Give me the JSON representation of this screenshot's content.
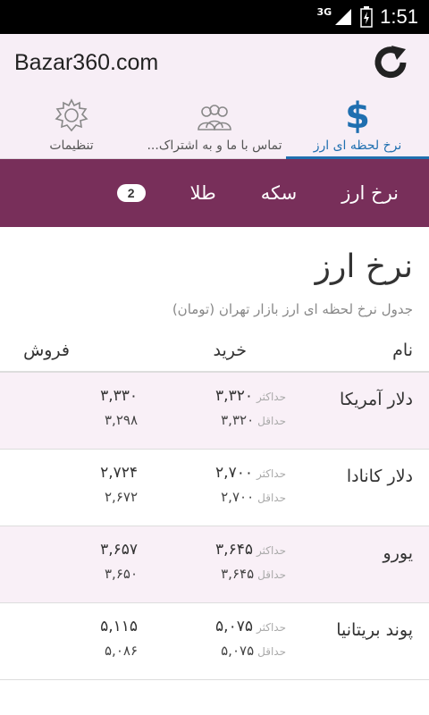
{
  "status": {
    "network": "3G",
    "time": "1:51"
  },
  "app": {
    "title": "Bazar360.com"
  },
  "tabs": [
    {
      "label": "نرخ لحظه ای ارز",
      "icon": "dollar-icon",
      "active": true
    },
    {
      "label": "...تماس با ما و به اشتراک",
      "icon": "people-icon",
      "active": false
    },
    {
      "label": "تنظیمات",
      "icon": "gear-icon",
      "active": false
    }
  ],
  "subnav": {
    "items": [
      "نرخ ارز",
      "سکه",
      "طلا"
    ],
    "badge": "2"
  },
  "page": {
    "title": "نرخ ارز",
    "subtitle": "جدول نرخ لحظه ای ارز بازار تهران (تومان)"
  },
  "table": {
    "headers": {
      "name": "نام",
      "buy": "خرید",
      "sell": "فروش"
    },
    "max_label": "حداکثر",
    "min_label": "حداقل",
    "rows": [
      {
        "name": "دلار آمریکا",
        "buy_max": "۳,۳۲۰",
        "buy_min": "۳,۳۲۰",
        "sell_max": "۳,۳۳۰",
        "sell_min": "۳,۲۹۸"
      },
      {
        "name": "دلار کانادا",
        "buy_max": "۲,۷۰۰",
        "buy_min": "۲,۷۰۰",
        "sell_max": "۲,۷۲۴",
        "sell_min": "۲,۶۷۲"
      },
      {
        "name": "یورو",
        "buy_max": "۳,۶۴۵",
        "buy_min": "۳,۶۴۵",
        "sell_max": "۳,۶۵۷",
        "sell_min": "۳,۶۵۰"
      },
      {
        "name": "پوند بریتانیا",
        "buy_max": "۵,۰۷۵",
        "buy_min": "۵,۰۷۵",
        "sell_max": "۵,۱۱۵",
        "sell_min": "۵,۰۸۶"
      }
    ]
  },
  "colors": {
    "accent": "#782f5a",
    "tab_active": "#1f6fb0",
    "bar_bg": "#f7eef6"
  }
}
